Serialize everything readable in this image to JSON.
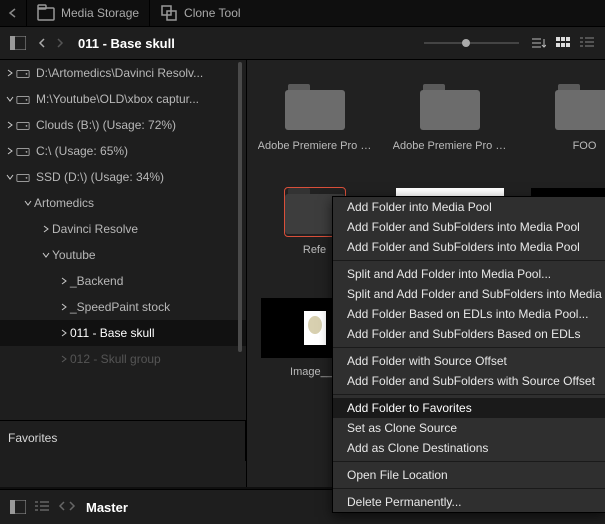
{
  "top": {
    "media_storage": "Media Storage",
    "clone_tool": "Clone Tool"
  },
  "header": {
    "title": "011 - Base skull"
  },
  "tree": {
    "root": [
      {
        "label": "D:\\Artomedics\\Davinci Resolv...",
        "exp": true
      },
      {
        "label": "M:\\Youtube\\OLD\\xbox captur...",
        "exp": false
      },
      {
        "label": "Clouds (B:\\) (Usage: 72%)",
        "exp": true
      },
      {
        "label": "C:\\ (Usage: 65%)",
        "exp": true
      },
      {
        "label": "SSD (D:\\) (Usage: 34%)",
        "exp": false
      }
    ],
    "artomedics": "Artomedics",
    "davinci": "Davinci Resolve",
    "youtube": "Youtube",
    "backend": "_Backend",
    "speedpaint": "_SpeedPaint stock",
    "baseskull": "011 - Base skull",
    "skullgroup": "012 - Skull group"
  },
  "favorites": "Favorites",
  "grid": {
    "r1": [
      "Adobe Premiere Pro …",
      "Adobe Premiere Pro …",
      "FOO"
    ],
    "r2": [
      "Refe"
    ],
    "r3": [
      "Image__It"
    ]
  },
  "menu": [
    "Add Folder into Media Pool",
    "Add Folder and SubFolders into Media Pool",
    "Add Folder and SubFolders into Media Pool",
    "---",
    "Split and Add Folder into Media Pool...",
    "Split and Add Folder and SubFolders into Media",
    "Add Folder Based on EDLs into Media Pool...",
    "Add Folder and SubFolders Based on EDLs",
    "---",
    "Add Folder with Source Offset",
    "Add Folder and SubFolders with Source Offset",
    "---",
    "Add Folder to Favorites",
    "Set as Clone Source",
    "Add as Clone Destinations",
    "---",
    "Open File Location",
    "---",
    "Delete Permanently..."
  ],
  "menu_highlight": 12,
  "footer": {
    "title": "Master"
  }
}
